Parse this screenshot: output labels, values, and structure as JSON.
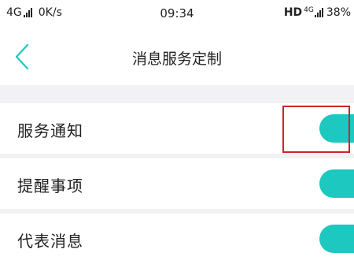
{
  "status_bar": {
    "network": "4G",
    "speed": "0K/s",
    "time": "09:34",
    "hd": "HD",
    "network_right": "4G",
    "battery": "38%"
  },
  "nav": {
    "back_icon": "chevron-left-icon",
    "title": "消息服务定制"
  },
  "settings": [
    {
      "label": "服务通知",
      "toggle_on": true,
      "highlighted": true
    },
    {
      "label": "提醒事项",
      "toggle_on": true
    },
    {
      "label": "代表消息",
      "toggle_on": true
    }
  ],
  "colors": {
    "accent": "#1cc8bf",
    "highlight": "#c8262c",
    "background": "#f2f2f4"
  }
}
